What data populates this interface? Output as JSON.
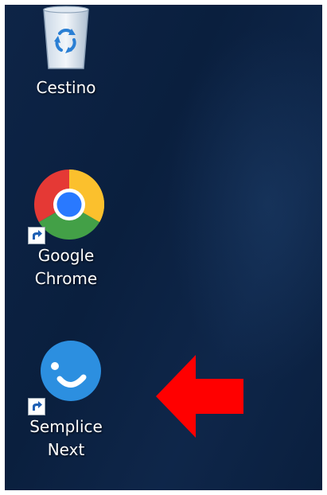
{
  "desktop": {
    "icons": [
      {
        "label": "Cestino",
        "icon": "recycle-bin-icon"
      },
      {
        "label": "Google\nChrome",
        "icon": "chrome-icon"
      },
      {
        "label": "Semplice\nNext",
        "icon": "semplice-next-icon"
      }
    ],
    "annotation": {
      "icon": "red-arrow-left",
      "color": "#ff0000"
    }
  }
}
